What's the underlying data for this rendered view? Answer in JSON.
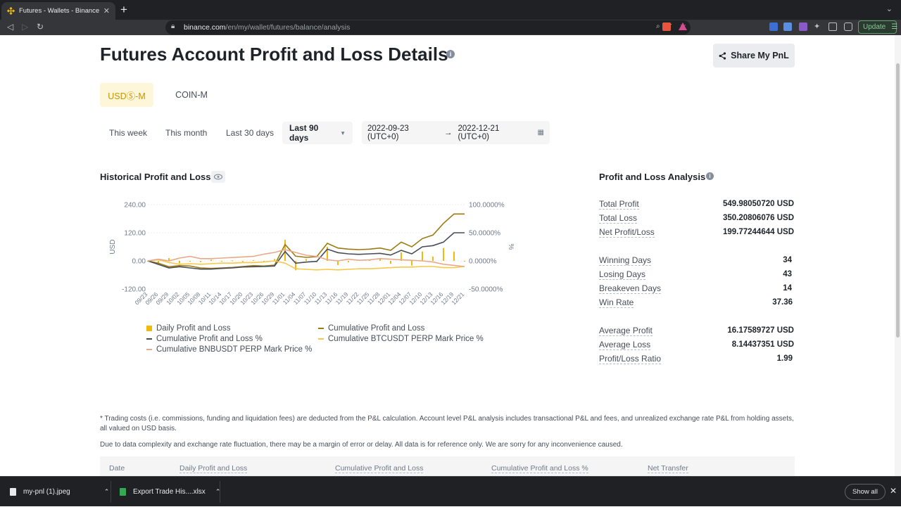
{
  "browser": {
    "tab_title": "Futures - Wallets - Binance",
    "tab_close": "✕",
    "new_tab": "+",
    "url_host": "binance.com",
    "url_path": "/en/my/wallet/futures/balance/analysis",
    "update_label": "Update"
  },
  "header": {
    "title": "Futures Account Profit and Loss Details",
    "info": "i",
    "share_label": "Share My PnL"
  },
  "segments": {
    "usdm": "USDⓈ-M",
    "coinm": "COIN-M"
  },
  "ranges": {
    "this_week": "This week",
    "this_month": "This month",
    "last_30": "Last 30 days",
    "last_90": "Last 90 days",
    "start": "2022-09-23 (UTC+0)",
    "arrow": "→",
    "end": "2022-12-21 (UTC+0)"
  },
  "history": {
    "title": "Historical Profit and Loss",
    "left_axis_label": "USD",
    "right_axis_label": "%",
    "left_ticks": [
      "240.00",
      "120.00",
      "0.00",
      "-120.00"
    ],
    "right_ticks": [
      "100.0000%",
      "50.0000%",
      "0.0000%",
      "-50.0000%"
    ],
    "x_ticks": [
      "09/23",
      "09/26",
      "09/29",
      "10/02",
      "10/05",
      "10/08",
      "10/11",
      "10/14",
      "10/17",
      "10/20",
      "10/23",
      "10/26",
      "10/29",
      "11/01",
      "11/04",
      "11/07",
      "11/10",
      "11/13",
      "11/16",
      "11/19",
      "11/22",
      "11/25",
      "11/28",
      "12/01",
      "12/04",
      "12/07",
      "12/10",
      "12/13",
      "12/16",
      "12/19",
      "12/21"
    ],
    "legend": {
      "daily": "Daily Profit and Loss",
      "cum": "Cumulative Profit and Loss",
      "cum_pct": "Cumulative Profit and Loss %",
      "btc": "Cumulative BTCUSDT PERP Mark Price %",
      "bnb": "Cumulative BNBUSDT PERP Mark Price %"
    },
    "colors": {
      "daily": "#f0b90b",
      "cum": "#9c7a12",
      "cum_pct": "#474d57",
      "btc": "#f5c84a",
      "bnb": "#e8a98a"
    }
  },
  "chart_data": {
    "type": "line",
    "x": [
      "09/23",
      "09/26",
      "09/29",
      "10/02",
      "10/05",
      "10/08",
      "10/11",
      "10/14",
      "10/17",
      "10/20",
      "10/23",
      "10/26",
      "10/29",
      "11/01",
      "11/04",
      "11/07",
      "11/10",
      "11/13",
      "11/16",
      "11/19",
      "11/22",
      "11/25",
      "11/28",
      "12/01",
      "12/04",
      "12/07",
      "12/10",
      "12/13",
      "12/16",
      "12/19",
      "12/21"
    ],
    "ylim": [
      -120,
      240
    ],
    "y2lim": [
      -50,
      100
    ],
    "series": [
      {
        "name": "Cumulative Profit and Loss",
        "axis": "left",
        "values": [
          0,
          -10,
          -25,
          -20,
          -22,
          -30,
          -32,
          -30,
          -28,
          -24,
          -20,
          -22,
          -18,
          70,
          20,
          15,
          18,
          75,
          55,
          50,
          48,
          50,
          55,
          45,
          80,
          60,
          95,
          110,
          160,
          200,
          200
        ]
      },
      {
        "name": "Cumulative Profit and Loss %",
        "axis": "left",
        "values": [
          0,
          -15,
          -30,
          -25,
          -30,
          -35,
          -35,
          -32,
          -30,
          -26,
          -25,
          -24,
          -22,
          40,
          -10,
          -5,
          -2,
          50,
          35,
          30,
          28,
          30,
          32,
          25,
          45,
          30,
          60,
          65,
          80,
          120,
          120
        ]
      },
      {
        "name": "Cumulative BTCUSDT PERP Mark Price %",
        "axis": "right",
        "values": [
          0,
          2,
          -3,
          -6,
          -5,
          -6,
          -5,
          -4,
          -4,
          -3,
          -3,
          -2,
          0,
          -4,
          -14,
          -15,
          -16,
          -15,
          -16,
          -15,
          -14,
          -14,
          -13,
          -12,
          -11,
          -11,
          -10,
          -10,
          -12,
          -12,
          -10
        ]
      },
      {
        "name": "Cumulative BNBUSDT PERP Mark Price %",
        "axis": "right",
        "values": [
          0,
          3,
          0,
          5,
          8,
          4,
          4,
          5,
          6,
          7,
          8,
          12,
          15,
          20,
          15,
          10,
          8,
          2,
          0,
          3,
          1,
          2,
          4,
          3,
          2,
          1,
          0,
          -2,
          -6,
          -8,
          -10
        ]
      },
      {
        "name": "Daily Profit and Loss",
        "axis": "left",
        "values": [
          0,
          -8,
          12,
          -10,
          0,
          -5,
          5,
          -3,
          2,
          -4,
          3,
          -2,
          8,
          90,
          -40,
          8,
          -6,
          60,
          -18,
          -6,
          4,
          6,
          8,
          -12,
          36,
          -20,
          40,
          18,
          55,
          40,
          0
        ]
      }
    ]
  },
  "analysis": {
    "title": "Profit and Loss Analysis",
    "info": "i",
    "rows": [
      {
        "label": "Total Profit",
        "value": "549.98050720 USD"
      },
      {
        "label": "Total Loss",
        "value": "350.20806076 USD"
      },
      {
        "label": "Net Profit/Loss",
        "value": "199.77244644 USD"
      },
      {
        "label": "Winning Days",
        "value": "34"
      },
      {
        "label": "Losing Days",
        "value": "43"
      },
      {
        "label": "Breakeven Days",
        "value": "14"
      },
      {
        "label": "Win Rate",
        "value": "37.36"
      },
      {
        "label": "Average Profit",
        "value": "16.17589727 USD"
      },
      {
        "label": "Average Loss",
        "value": "8.14437351 USD"
      },
      {
        "label": "Profit/Loss Ratio",
        "value": "1.99"
      }
    ]
  },
  "notes": {
    "n1": "* Trading costs (i.e. commissions, funding and liquidation fees) are deducted from the P&L calculation. Account level P&L analysis includes transactional P&L and fees, and unrealized exchange rate P&L from holding assets, all valued on USD basis.",
    "n2": "Due to data complexity and exchange rate fluctuation, there may be a margin of error or delay. All data is for reference only. We are sorry for any inconvenience caused."
  },
  "table": {
    "headers": [
      "Date",
      "Daily Profit and Loss",
      "Cumulative Profit and Loss",
      "Cumulative Profit and Loss %",
      "Net Transfer"
    ]
  },
  "downloads": {
    "file1": "my-pnl (1).jpeg",
    "file2": "Export Trade His....xlsx",
    "show_all": "Show all",
    "close": "✕"
  }
}
